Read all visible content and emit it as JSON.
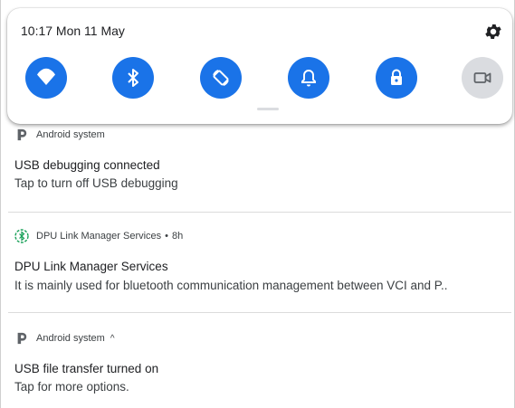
{
  "quick_settings": {
    "status": "10:17 Mon 11 May",
    "tiles": [
      {
        "name": "wifi",
        "state": "on"
      },
      {
        "name": "bluetooth",
        "state": "on"
      },
      {
        "name": "auto-rotate",
        "state": "on"
      },
      {
        "name": "do-not-disturb",
        "state": "on"
      },
      {
        "name": "location-lock",
        "state": "on"
      },
      {
        "name": "screen-record",
        "state": "off"
      }
    ],
    "active_color": "#1a73e8",
    "inactive_color": "#dadce0"
  },
  "notifications": [
    {
      "app": "Android system",
      "title": "USB debugging connected",
      "text": "Tap to turn off USB debugging"
    },
    {
      "app": "DPU Link Manager Services",
      "time": "8h",
      "title": "DPU Link Manager Services",
      "text": "It is mainly used for bluetooth communication management between VCI and P.."
    },
    {
      "app": "Android system",
      "expand": "^",
      "title": "USB file transfer turned on",
      "text": "Tap for more options."
    }
  ]
}
